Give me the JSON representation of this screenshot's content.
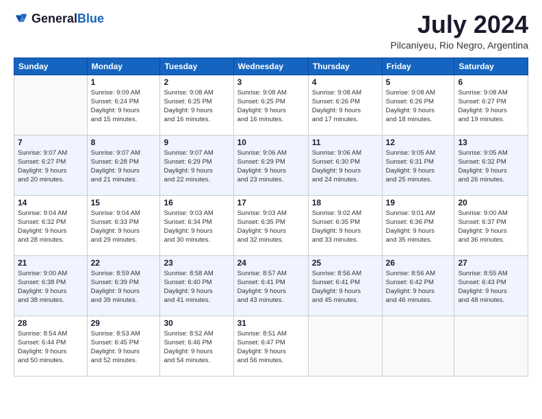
{
  "logo": {
    "general": "General",
    "blue": "Blue"
  },
  "title": "July 2024",
  "location": "Pilcaniyeu, Rio Negro, Argentina",
  "weekdays": [
    "Sunday",
    "Monday",
    "Tuesday",
    "Wednesday",
    "Thursday",
    "Friday",
    "Saturday"
  ],
  "weeks": [
    [
      {
        "day": "",
        "sunrise": "",
        "sunset": "",
        "daylight": ""
      },
      {
        "day": "1",
        "sunrise": "Sunrise: 9:09 AM",
        "sunset": "Sunset: 6:24 PM",
        "daylight": "Daylight: 9 hours and 15 minutes."
      },
      {
        "day": "2",
        "sunrise": "Sunrise: 9:08 AM",
        "sunset": "Sunset: 6:25 PM",
        "daylight": "Daylight: 9 hours and 16 minutes."
      },
      {
        "day": "3",
        "sunrise": "Sunrise: 9:08 AM",
        "sunset": "Sunset: 6:25 PM",
        "daylight": "Daylight: 9 hours and 16 minutes."
      },
      {
        "day": "4",
        "sunrise": "Sunrise: 9:08 AM",
        "sunset": "Sunset: 6:26 PM",
        "daylight": "Daylight: 9 hours and 17 minutes."
      },
      {
        "day": "5",
        "sunrise": "Sunrise: 9:08 AM",
        "sunset": "Sunset: 6:26 PM",
        "daylight": "Daylight: 9 hours and 18 minutes."
      },
      {
        "day": "6",
        "sunrise": "Sunrise: 9:08 AM",
        "sunset": "Sunset: 6:27 PM",
        "daylight": "Daylight: 9 hours and 19 minutes."
      }
    ],
    [
      {
        "day": "7",
        "sunrise": "Sunrise: 9:07 AM",
        "sunset": "Sunset: 6:27 PM",
        "daylight": "Daylight: 9 hours and 20 minutes."
      },
      {
        "day": "8",
        "sunrise": "Sunrise: 9:07 AM",
        "sunset": "Sunset: 6:28 PM",
        "daylight": "Daylight: 9 hours and 21 minutes."
      },
      {
        "day": "9",
        "sunrise": "Sunrise: 9:07 AM",
        "sunset": "Sunset: 6:29 PM",
        "daylight": "Daylight: 9 hours and 22 minutes."
      },
      {
        "day": "10",
        "sunrise": "Sunrise: 9:06 AM",
        "sunset": "Sunset: 6:29 PM",
        "daylight": "Daylight: 9 hours and 23 minutes."
      },
      {
        "day": "11",
        "sunrise": "Sunrise: 9:06 AM",
        "sunset": "Sunset: 6:30 PM",
        "daylight": "Daylight: 9 hours and 24 minutes."
      },
      {
        "day": "12",
        "sunrise": "Sunrise: 9:05 AM",
        "sunset": "Sunset: 6:31 PM",
        "daylight": "Daylight: 9 hours and 25 minutes."
      },
      {
        "day": "13",
        "sunrise": "Sunrise: 9:05 AM",
        "sunset": "Sunset: 6:32 PM",
        "daylight": "Daylight: 9 hours and 26 minutes."
      }
    ],
    [
      {
        "day": "14",
        "sunrise": "Sunrise: 9:04 AM",
        "sunset": "Sunset: 6:32 PM",
        "daylight": "Daylight: 9 hours and 28 minutes."
      },
      {
        "day": "15",
        "sunrise": "Sunrise: 9:04 AM",
        "sunset": "Sunset: 6:33 PM",
        "daylight": "Daylight: 9 hours and 29 minutes."
      },
      {
        "day": "16",
        "sunrise": "Sunrise: 9:03 AM",
        "sunset": "Sunset: 6:34 PM",
        "daylight": "Daylight: 9 hours and 30 minutes."
      },
      {
        "day": "17",
        "sunrise": "Sunrise: 9:03 AM",
        "sunset": "Sunset: 6:35 PM",
        "daylight": "Daylight: 9 hours and 32 minutes."
      },
      {
        "day": "18",
        "sunrise": "Sunrise: 9:02 AM",
        "sunset": "Sunset: 6:35 PM",
        "daylight": "Daylight: 9 hours and 33 minutes."
      },
      {
        "day": "19",
        "sunrise": "Sunrise: 9:01 AM",
        "sunset": "Sunset: 6:36 PM",
        "daylight": "Daylight: 9 hours and 35 minutes."
      },
      {
        "day": "20",
        "sunrise": "Sunrise: 9:00 AM",
        "sunset": "Sunset: 6:37 PM",
        "daylight": "Daylight: 9 hours and 36 minutes."
      }
    ],
    [
      {
        "day": "21",
        "sunrise": "Sunrise: 9:00 AM",
        "sunset": "Sunset: 6:38 PM",
        "daylight": "Daylight: 9 hours and 38 minutes."
      },
      {
        "day": "22",
        "sunrise": "Sunrise: 8:59 AM",
        "sunset": "Sunset: 6:39 PM",
        "daylight": "Daylight: 9 hours and 39 minutes."
      },
      {
        "day": "23",
        "sunrise": "Sunrise: 8:58 AM",
        "sunset": "Sunset: 6:40 PM",
        "daylight": "Daylight: 9 hours and 41 minutes."
      },
      {
        "day": "24",
        "sunrise": "Sunrise: 8:57 AM",
        "sunset": "Sunset: 6:41 PM",
        "daylight": "Daylight: 9 hours and 43 minutes."
      },
      {
        "day": "25",
        "sunrise": "Sunrise: 8:56 AM",
        "sunset": "Sunset: 6:41 PM",
        "daylight": "Daylight: 9 hours and 45 minutes."
      },
      {
        "day": "26",
        "sunrise": "Sunrise: 8:56 AM",
        "sunset": "Sunset: 6:42 PM",
        "daylight": "Daylight: 9 hours and 46 minutes."
      },
      {
        "day": "27",
        "sunrise": "Sunrise: 8:55 AM",
        "sunset": "Sunset: 6:43 PM",
        "daylight": "Daylight: 9 hours and 48 minutes."
      }
    ],
    [
      {
        "day": "28",
        "sunrise": "Sunrise: 8:54 AM",
        "sunset": "Sunset: 6:44 PM",
        "daylight": "Daylight: 9 hours and 50 minutes."
      },
      {
        "day": "29",
        "sunrise": "Sunrise: 8:53 AM",
        "sunset": "Sunset: 6:45 PM",
        "daylight": "Daylight: 9 hours and 52 minutes."
      },
      {
        "day": "30",
        "sunrise": "Sunrise: 8:52 AM",
        "sunset": "Sunset: 6:46 PM",
        "daylight": "Daylight: 9 hours and 54 minutes."
      },
      {
        "day": "31",
        "sunrise": "Sunrise: 8:51 AM",
        "sunset": "Sunset: 6:47 PM",
        "daylight": "Daylight: 9 hours and 56 minutes."
      },
      {
        "day": "",
        "sunrise": "",
        "sunset": "",
        "daylight": ""
      },
      {
        "day": "",
        "sunrise": "",
        "sunset": "",
        "daylight": ""
      },
      {
        "day": "",
        "sunrise": "",
        "sunset": "",
        "daylight": ""
      }
    ]
  ]
}
